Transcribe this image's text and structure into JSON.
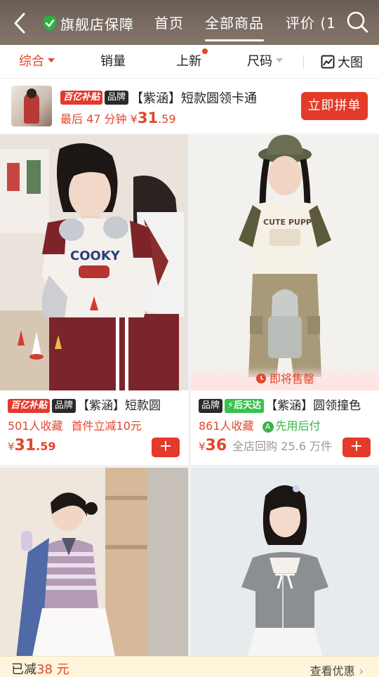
{
  "header": {
    "guarantee_label": "旗舰店保障",
    "tabs": [
      "首页",
      "全部商品",
      "评价 (1"
    ],
    "active_tab": "全部商品"
  },
  "filters": {
    "items": [
      "综合",
      "销量",
      "上新",
      "尺码"
    ],
    "big_view": "大图"
  },
  "group_buy": {
    "tag_subsidy": "百亿补贴",
    "tag_brand": "品牌",
    "title": "【紫涵】短款圆领卡通",
    "countdown": "最后 47 分钟",
    "price_symbol": "¥",
    "price_int": "31",
    "price_dec": ".59",
    "button": "立即拼单"
  },
  "products": [
    {
      "tags": [
        "百亿补贴",
        "品牌"
      ],
      "title": "【紫涵】短款圆",
      "favorites": "501人收藏",
      "promo": "首件立减10元",
      "price_symbol": "¥",
      "price_int": "31",
      "price_dec": ".59",
      "add": "+"
    },
    {
      "tags": [
        "品牌",
        "后天达"
      ],
      "title": "【紫涵】圆领撞色",
      "favorites": "861人收藏",
      "promo": "先用后付",
      "price_symbol": "¥",
      "price_int": "36",
      "price_dec": "",
      "sub": "全店回购 25.6 万件",
      "soon": "即将售罄",
      "add": "+"
    }
  ],
  "coupon_bar": {
    "prefix": "已减",
    "amount": "38 元",
    "link": "查看优惠"
  }
}
